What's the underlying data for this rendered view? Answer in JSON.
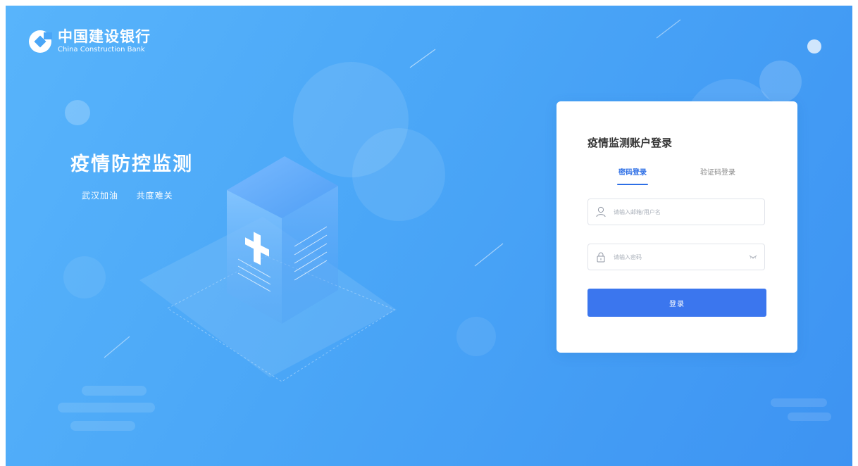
{
  "brand": {
    "name_cn": "中国建设银行",
    "name_en": "China Construction Bank",
    "logo_icon": "ccb-logo-icon"
  },
  "hero": {
    "title": "疫情防控监测",
    "subtitle": "武汉加油  共度难关",
    "illustration": "medical-cube-illustration"
  },
  "login": {
    "title": "疫情监测账户登录",
    "tabs": [
      {
        "label": "密码登录",
        "active": true
      },
      {
        "label": "验证码登录",
        "active": false
      }
    ],
    "username": {
      "placeholder": "请输入邮箱/用户名",
      "value": "",
      "icon": "user-icon"
    },
    "password": {
      "placeholder": "请输入密码",
      "value": "",
      "icon": "lock-icon",
      "toggle_icon": "eye-closed-icon"
    },
    "submit_label": "登录"
  },
  "colors": {
    "background_start": "#58b4fb",
    "background_end": "#3d93f2",
    "accent": "#3b76ee",
    "card": "#ffffff"
  }
}
